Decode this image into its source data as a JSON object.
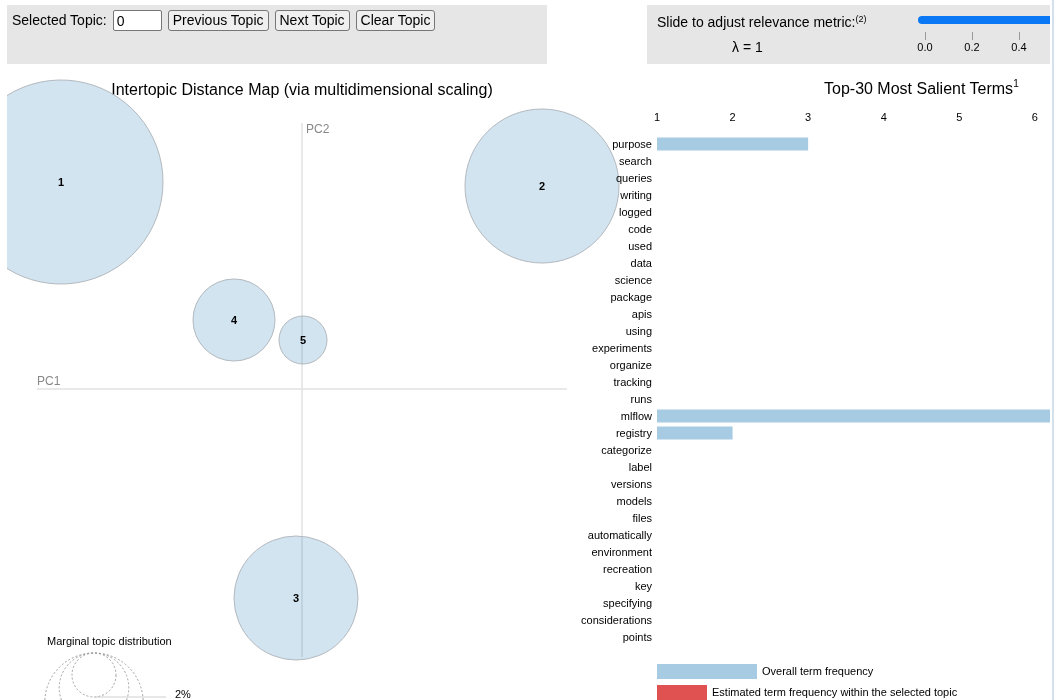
{
  "topic_controls": {
    "label": "Selected Topic:",
    "value": "0",
    "buttons": [
      "Previous Topic",
      "Next Topic",
      "Clear Topic"
    ]
  },
  "relevance_slider": {
    "label": "Slide to adjust relevance metric:$^{(2)}$",
    "lambda_text": "λ = 1",
    "level": 1,
    "ticks": [
      "0.0",
      "0.2",
      "0.4"
    ]
  },
  "topic_map": {
    "title": "Intertopic Distance Map (via multidimensional scaling)",
    "x_axis_label": "PC1",
    "y_axis_label": "PC2",
    "topics": [
      {
        "label": "1",
        "selected": false
      },
      {
        "label": "2",
        "selected": false
      },
      {
        "label": "3",
        "selected": false
      },
      {
        "label": "4",
        "selected": false
      },
      {
        "label": "5",
        "selected": false
      }
    ],
    "size_legend": {
      "title": "Marginal topic distribution",
      "label": "2%"
    }
  },
  "term_chart": {
    "chart_data": {
      "type": "bar",
      "orientation": "horizontal",
      "title": "Top-30 Most Salient Terms$^{1}$",
      "categories": [
        "purpose",
        "search",
        "queries",
        "writing",
        "logged",
        "code",
        "used",
        "data",
        "science",
        "package",
        "apis",
        "using",
        "experiments",
        "organize",
        "tracking",
        "runs",
        "mlflow",
        "registry",
        "categorize",
        "label",
        "versions",
        "models",
        "files",
        "automatically",
        "environment",
        "recreation",
        "key",
        "specifying",
        "considerations",
        "points"
      ],
      "series": [
        {
          "color": "#a6cbe3",
          "values": [
            3,
            1,
            1,
            1,
            1,
            1,
            1,
            1,
            1,
            1,
            1,
            1,
            1,
            1,
            1,
            1,
            6.2,
            2,
            1,
            1,
            1,
            1,
            1,
            1,
            1,
            1,
            1,
            1,
            1,
            1
          ]
        }
      ],
      "xlim": [
        1,
        6.2
      ],
      "xticks": [
        1,
        2,
        3,
        4,
        5,
        6
      ]
    },
    "legend": [
      {
        "label": "Overall term frequency",
        "color": "#a6cbe3"
      },
      {
        "label": "Estimated term frequency within the selected topic",
        "color": "#e05252"
      }
    ]
  }
}
